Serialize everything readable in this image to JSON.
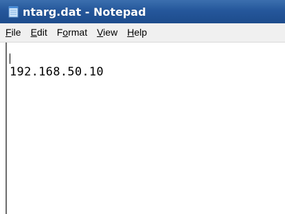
{
  "window": {
    "title": "ntarg.dat - Notepad",
    "icon": "notepad-icon"
  },
  "menu": {
    "items": [
      {
        "label": "File",
        "accel_index": 0
      },
      {
        "label": "Edit",
        "accel_index": 0
      },
      {
        "label": "Format",
        "accel_index": 1
      },
      {
        "label": "View",
        "accel_index": 0
      },
      {
        "label": "Help",
        "accel_index": 0
      }
    ]
  },
  "editor": {
    "text": "192.168.50.10"
  },
  "colors": {
    "titlebar": "#25579b",
    "menubar": "#f0f0f0",
    "editor_bg": "#ffffff"
  }
}
